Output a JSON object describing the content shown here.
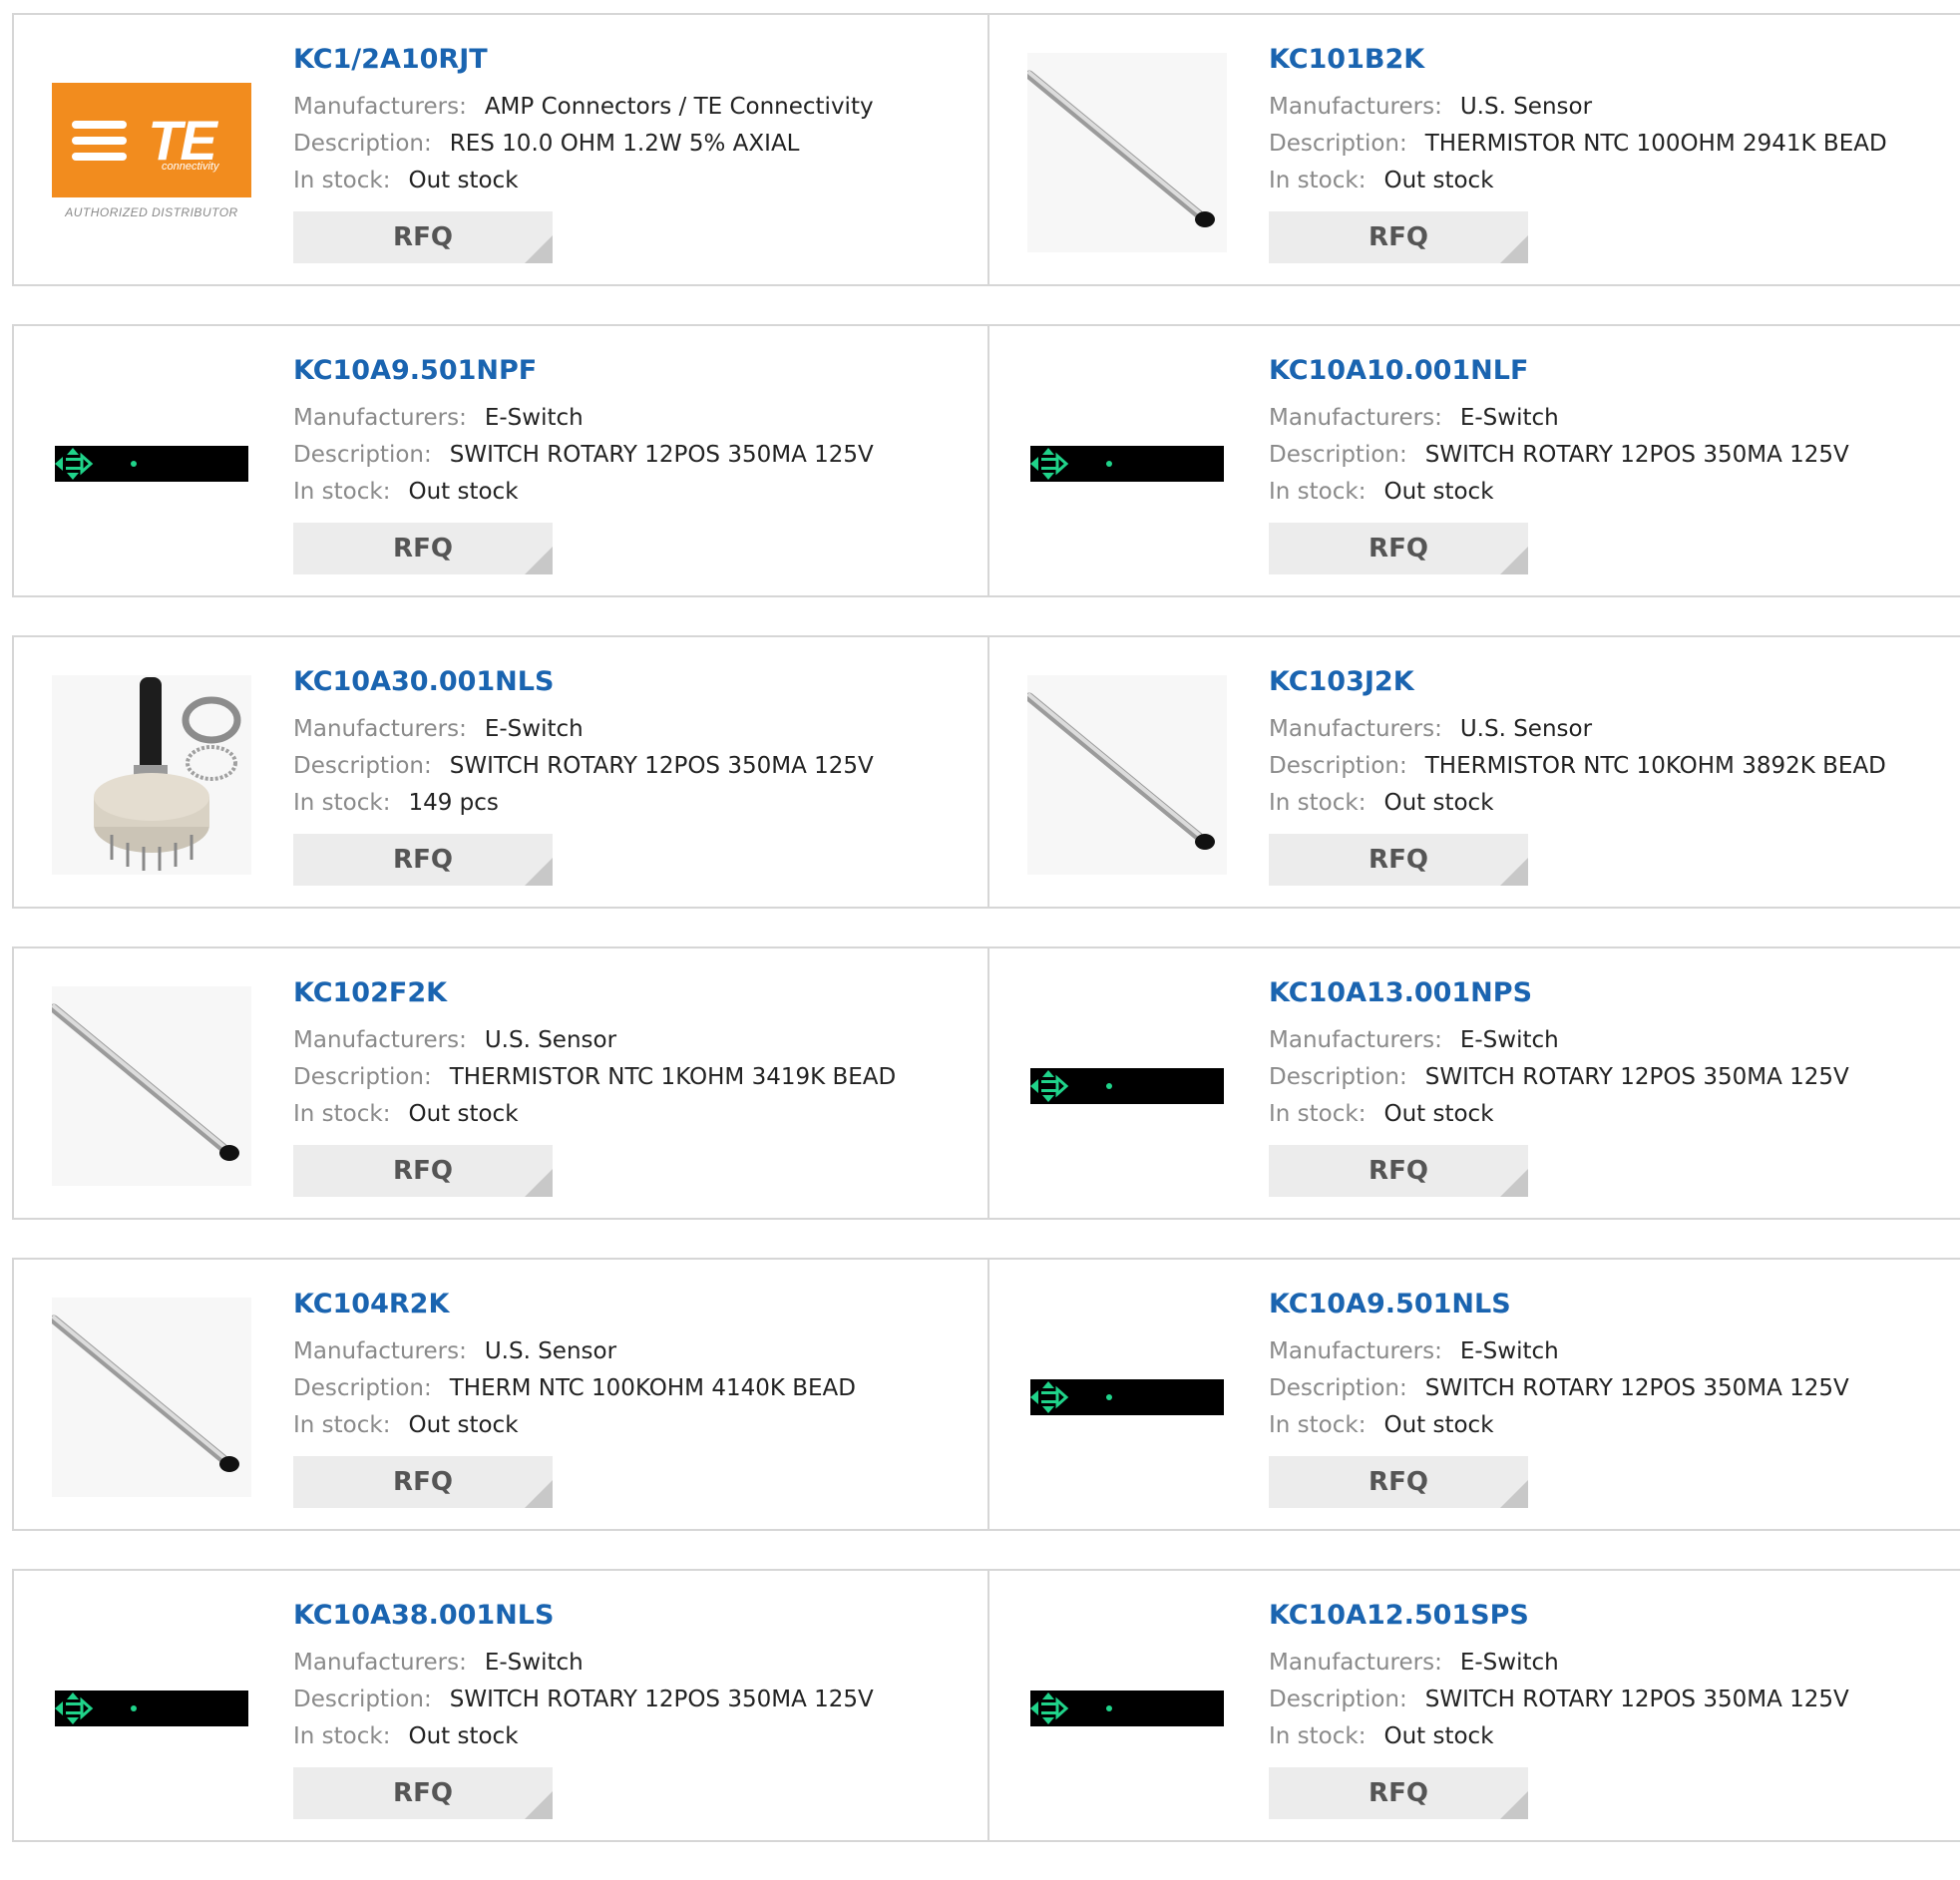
{
  "labels": {
    "manufacturers": "Manufacturers:",
    "description": "Description:",
    "in_stock": "In stock:",
    "rfq": "RFQ"
  },
  "logo": {
    "te_text": "TE",
    "te_sub": "connectivity",
    "authorized": "AUTHORIZED DISTRIBUTOR"
  },
  "colors": {
    "part_number": "#1a64b0",
    "te_orange": "#f28c1e",
    "strip_green": "#20d38a"
  },
  "products": [
    {
      "part": "KC1/2A10RJT",
      "manufacturer": "AMP Connectors / TE Connectivity",
      "description": "RES 10.0 OHM 1.2W 5% AXIAL",
      "stock": "Out stock",
      "image": "te-logo"
    },
    {
      "part": "KC101B2K",
      "manufacturer": "U.S. Sensor",
      "description": "THERMISTOR NTC 100OHM 2941K BEAD",
      "stock": "Out stock",
      "image": "thermistor-probe"
    },
    {
      "part": "KC10A9.501NPF",
      "manufacturer": "E-Switch",
      "description": "SWITCH ROTARY 12POS 350MA 125V",
      "stock": "Out stock",
      "image": "switch-strip"
    },
    {
      "part": "KC10A10.001NLF",
      "manufacturer": "E-Switch",
      "description": "SWITCH ROTARY 12POS 350MA 125V",
      "stock": "Out stock",
      "image": "switch-strip"
    },
    {
      "part": "KC10A30.001NLS",
      "manufacturer": "E-Switch",
      "description": "SWITCH ROTARY 12POS 350MA 125V",
      "stock": "149 pcs",
      "image": "rotary-switch"
    },
    {
      "part": "KC103J2K",
      "manufacturer": "U.S. Sensor",
      "description": "THERMISTOR NTC 10KOHM 3892K BEAD",
      "stock": "Out stock",
      "image": "thermistor-probe"
    },
    {
      "part": "KC102F2K",
      "manufacturer": "U.S. Sensor",
      "description": "THERMISTOR NTC 1KOHM 3419K BEAD",
      "stock": "Out stock",
      "image": "thermistor-probe"
    },
    {
      "part": "KC10A13.001NPS",
      "manufacturer": "E-Switch",
      "description": "SWITCH ROTARY 12POS 350MA 125V",
      "stock": "Out stock",
      "image": "switch-strip"
    },
    {
      "part": "KC104R2K",
      "manufacturer": "U.S. Sensor",
      "description": "THERM NTC 100KOHM 4140K BEAD",
      "stock": "Out stock",
      "image": "thermistor-probe"
    },
    {
      "part": "KC10A9.501NLS",
      "manufacturer": "E-Switch",
      "description": "SWITCH ROTARY 12POS 350MA 125V",
      "stock": "Out stock",
      "image": "switch-strip"
    },
    {
      "part": "KC10A38.001NLS",
      "manufacturer": "E-Switch",
      "description": "SWITCH ROTARY 12POS 350MA 125V",
      "stock": "Out stock",
      "image": "switch-strip"
    },
    {
      "part": "KC10A12.501SPS",
      "manufacturer": "E-Switch",
      "description": "SWITCH ROTARY 12POS 350MA 125V",
      "stock": "Out stock",
      "image": "switch-strip"
    }
  ]
}
